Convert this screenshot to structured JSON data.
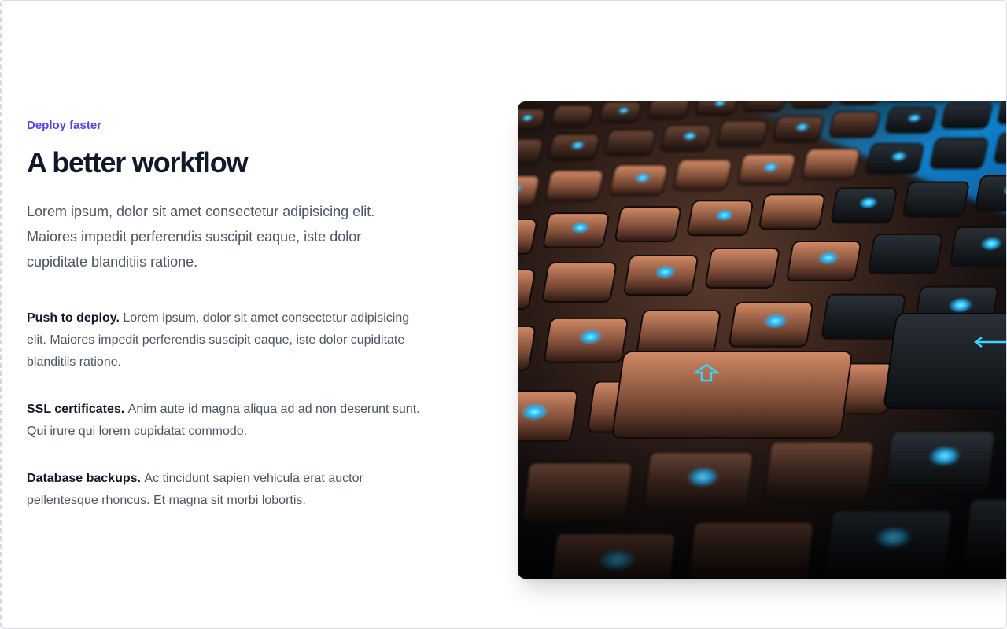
{
  "hero": {
    "eyebrow": "Deploy faster",
    "title": "A better workflow",
    "lead": "Lorem ipsum, dolor sit amet consectetur adipisicing elit. Maiores impedit perferendis suscipit eaque, iste dolor cupiditate blanditiis ratione."
  },
  "features": [
    {
      "name": "Push to deploy.",
      "description": "Lorem ipsum, dolor sit amet consectetur adipisicing elit. Maiores impedit perferendis suscipit eaque, iste dolor cupiditate blanditiis ratione."
    },
    {
      "name": "SSL certificates.",
      "description": "Anim aute id magna aliqua ad ad non deserunt sunt. Qui irure qui lorem cupidatat commodo."
    },
    {
      "name": "Database backups.",
      "description": "Ac tincidunt sapien vehicula erat auctor pellentesque rhoncus. Et magna sit morbi lobortis."
    }
  ],
  "image": {
    "subject": "backlit-keyboard-photo"
  },
  "colors": {
    "accent": "#4f46e5",
    "heading": "#111827",
    "body": "#4b5563",
    "key_glow": "#2ec8ff",
    "key_warm": "#c9825f"
  }
}
